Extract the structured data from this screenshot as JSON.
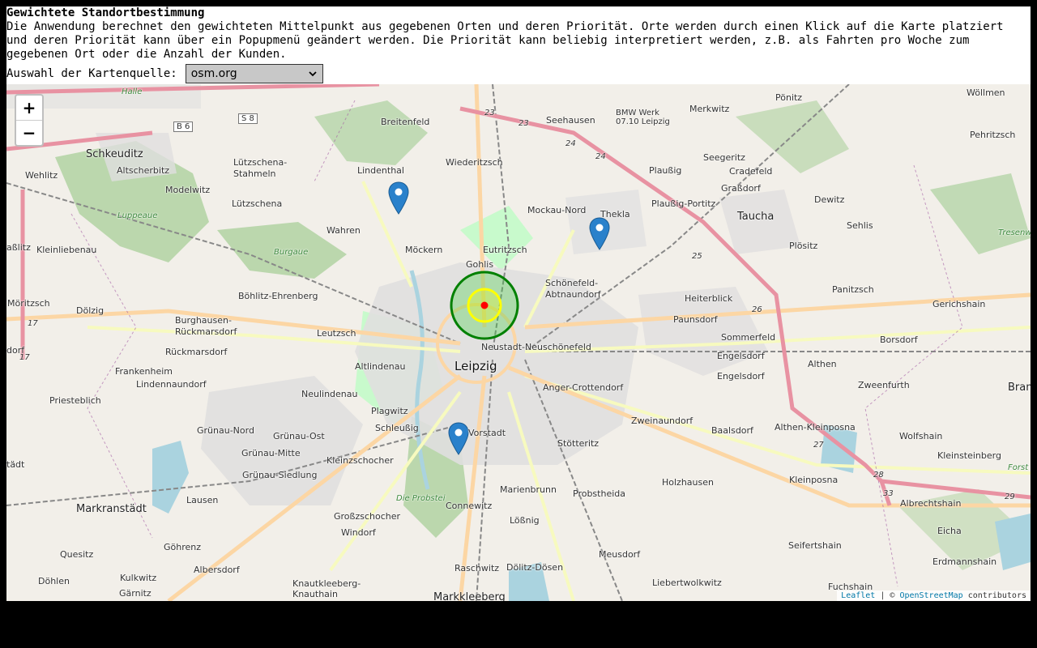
{
  "header": {
    "title": "Gewichtete Standortbestimmung",
    "description": "Die Anwendung berechnet den gewichteten Mittelpunkt aus gegebenen Orten und deren Priorität. Orte werden durch einen Klick auf die Karte platziert und deren Priorität kann über ein Popupmenü geändert werden. Die Priorität kann beliebig interpretiert werden, z.B. als Fahrten pro Woche zum gegebenen Ort oder die Anzahl der Kunden."
  },
  "map_source": {
    "label": "Auswahl der Kartenquelle:",
    "selected": "osm.org"
  },
  "zoom": {
    "in": "+",
    "out": "−"
  },
  "attribution": {
    "leaflet": "Leaflet",
    "separator": " | © ",
    "osm": "OpenStreetMap",
    "suffix": " contributors"
  },
  "map_labels": {
    "leipzig": "Leipzig",
    "schkeuditz": "Schkeuditz",
    "taucha": "Taucha",
    "markranstaedt": "Markranstädt",
    "breitenfeld": "Breitenfeld",
    "seehausen": "Seehausen",
    "bmw": "BMW Werk\n07.10 Leipzig",
    "merkwitz": "Merkwitz",
    "ponitz": "Pönitz",
    "woellmen": "Wöllmen",
    "pehritzsch": "Pehritzsch",
    "seegeritz": "Seegeritz",
    "cradefeld": "Cradefeld",
    "grassdorf": "Graßdorf",
    "plaussig": "Plaußig",
    "wiederitzsch": "Wiederitzsch",
    "lindenthal": "Lindenthal",
    "luetzschena": "Lützschena-\nStahmeln",
    "altscherbitz": "Altscherbitz",
    "wehlitz": "Wehlitz",
    "modelwitz": "Modelwitz",
    "luetzschena2": "Lützschena",
    "luppeaue": "Luppeaue",
    "burgaue": "Burgaue",
    "wahren": "Wahren",
    "moeckern": "Möckern",
    "eutritzsch": "Eutritzsch",
    "gohlis": "Gohlis",
    "mockau": "Mockau-Nord",
    "thekla": "Thekla",
    "plaussig_portitz": "Plaußig-Portitz",
    "dewitz": "Dewitz",
    "sehlis": "Sehlis",
    "ploesitz": "Plösitz",
    "panitzsch": "Panitzsch",
    "gerichshain": "Gerichshain",
    "schoenefeld": "Schönefeld-\nAbtnaundorf",
    "heiterblick": "Heiterblick",
    "paunsdorf": "Paunsdorf",
    "sommerfeld": "Sommerfeld",
    "borsdorf": "Borsdorf",
    "engelsdorf1": "Engelsdorf",
    "engelsdorf2": "Engelsdorf",
    "althen": "Althen",
    "zweenfurth": "Zweenfurth",
    "neustadt": "Neustadt-Neuschönefeld",
    "anger": "Anger-Crottendorf",
    "zweinaundorf": "Zweinaundorf",
    "baalsdorf": "Baalsdorf",
    "althen_kp": "Althen-Kleinposna",
    "wolfshain": "Wolfshain",
    "kleinsteinberg": "Kleinsteinberg",
    "kleinposna": "Kleinposna",
    "albrechtshain": "Albrechtshain",
    "eicha": "Eicha",
    "erdmannshain": "Erdmannshain",
    "seifertshain": "Seifertshain",
    "fuchshain": "Fuchshain",
    "holzhausen": "Holzhausen",
    "stoetteritz": "Stötteritz",
    "probstheida": "Probstheida",
    "meusdorf": "Meusdorf",
    "liebertwolkwitz": "Liebertwolkwitz",
    "marienbrunn": "Marienbrunn",
    "loessnig": "Lößnig",
    "doelitz": "Dölitz-Dösen",
    "connewitz": "Connewitz",
    "raschwitz": "Raschwitz",
    "markkleeberg": "Markkleeberg",
    "vorstadt": "Vorstadt",
    "schleussig": "Schleußig",
    "plagwitz": "Plagwitz",
    "kleinzschocher": "Kleinzschocher",
    "grosszschocher": "Großzschocher",
    "windorf": "Windorf",
    "probstei": "Die Probstei",
    "knautkleeberg": "Knautkleeberg-\nKnauthain",
    "albersdorf": "Albersdorf",
    "goehrenz": "Göhrenz",
    "kulkwitz": "Kulkwitz",
    "gaernitz": "Gärnitz",
    "doehlen": "Döhlen",
    "quesitz": "Quesitz",
    "lausen": "Lausen",
    "gruenau_siedlung": "Grünau-Siedlung",
    "gruenau_mitte": "Grünau-Mitte",
    "gruenau_ost": "Grünau-Ost",
    "gruenau_nord": "Grünau-Nord",
    "neulindenau": "Neulindenau",
    "altlindenau": "Altlindenau",
    "leutzsch": "Leutzsch",
    "boehlitz": "Böhlitz-Ehrenberg",
    "burghausen": "Burghausen-\nRückmarsdorf",
    "rueckmarsdorf": "Rückmarsdorf",
    "frankenheim": "Frankenheim",
    "lindennaundorf": "Lindennaundorf",
    "priesteblich": "Priesteblich",
    "doelzig": "Dölzig",
    "moeritzsch": "Möritzsch",
    "kleinliebenau": "Kleinliebenau",
    "dasslitz": "aßlitz",
    "dorf": "dorf",
    "stadt": "tädt",
    "bran": "Bran",
    "tresenwald": "Tresenwalde",
    "forst": "Forst",
    "halle": "Halle"
  },
  "road_labels": {
    "b6": "B 6",
    "s8": "S 8",
    "a23a": "23",
    "a23b": "23",
    "a24a": "24",
    "a24b": "24",
    "a25": "25",
    "a26": "26",
    "a27": "27",
    "a28": "28",
    "a33": "33",
    "a29": "29",
    "a17a": "17",
    "a17b": "17"
  },
  "colors": {
    "map_bg": "#f2efe9",
    "forest": "#add19e",
    "park": "#c8facc",
    "urban": "#e0dfdf",
    "water": "#aad3df",
    "motorway": "#e892a2",
    "trunk": "#f9b29c",
    "primary": "#fcd6a4",
    "secondary": "#f7fabf",
    "rail": "#999999",
    "marker": "#2a81cb",
    "circle_outer": "#008000",
    "circle_inner": "#ffff00",
    "center": "#ff0000"
  },
  "markers": [
    "marker-north-west",
    "marker-north-east",
    "marker-south"
  ]
}
